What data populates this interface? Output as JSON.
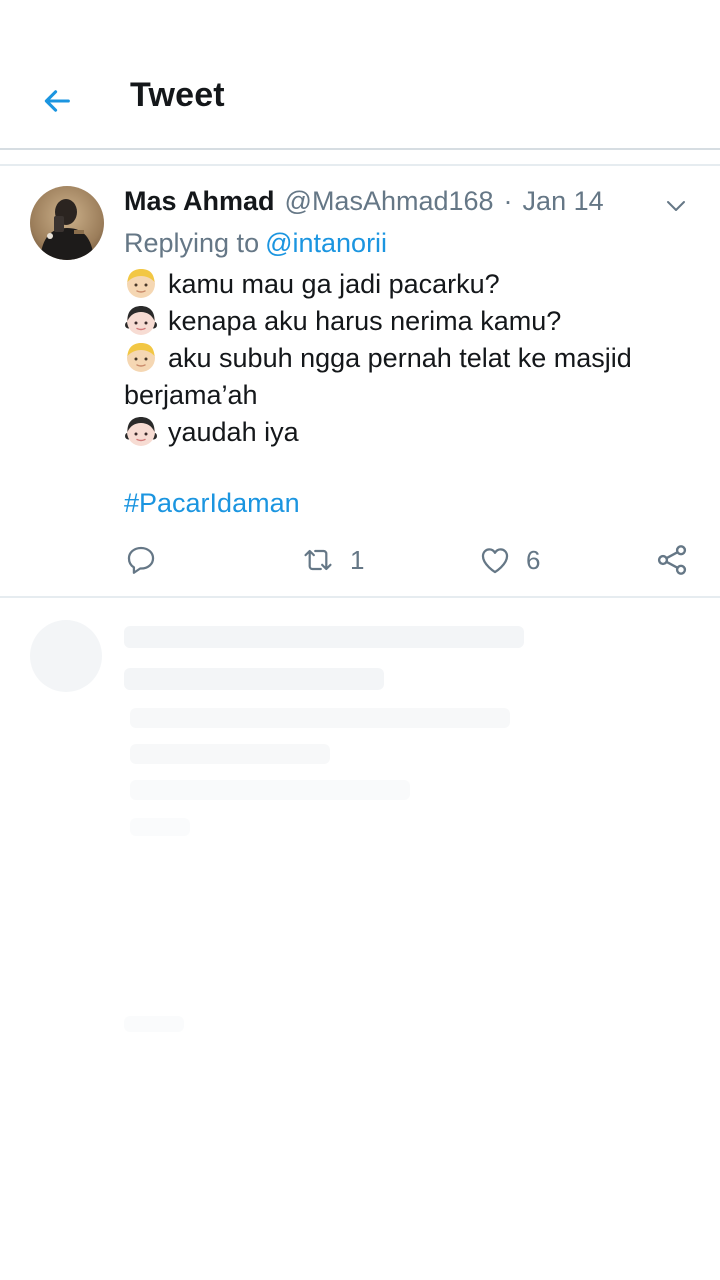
{
  "header": {
    "title": "Tweet",
    "back_icon": "arrow-left-icon"
  },
  "tweet": {
    "author_name": "Mas Ahmad",
    "author_handle": "@MasAhmad168",
    "separator": "·",
    "date": "Jan 14",
    "reply_prefix": "Replying to",
    "reply_to": "@intanorii",
    "lines": [
      "kamu mau ga jadi pacarku?",
      "kenapa aku harus nerima kamu?",
      "aku subuh ngga pernah telat ke masjid",
      "berjama’ah",
      "yaudah iya"
    ],
    "hashtag": "#PacarIdaman",
    "retweet_count": "1",
    "like_count": "6"
  },
  "colors": {
    "accent": "#1b95e0",
    "text_primary": "#14171a",
    "text_secondary": "#657786",
    "divider": "#e6ecf0"
  },
  "icons": {
    "boy": "boy-emoji-icon",
    "girl": "girl-emoji-icon",
    "reply": "reply-icon",
    "retweet": "retweet-icon",
    "like": "heart-icon",
    "share": "share-icon",
    "caret": "chevron-down-icon"
  }
}
